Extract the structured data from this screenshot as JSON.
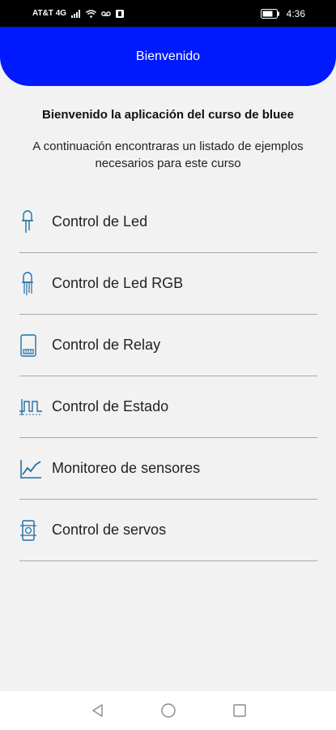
{
  "status_bar": {
    "carrier": "AT&T 4G",
    "time": "4:36",
    "icons": [
      "signal-icon",
      "wifi-icon",
      "voicemail-icon",
      "notification-icon",
      "battery-icon"
    ]
  },
  "header": {
    "title": "Bienvenido"
  },
  "intro": {
    "title": "Bienvenido la aplicación del curso de bluee",
    "description": "A continuación encontraras un listado de ejemplos necesarios para este curso"
  },
  "menu": {
    "items": [
      {
        "label": "Control de Led",
        "icon": "led-icon"
      },
      {
        "label": "Control de Led RGB",
        "icon": "led-rgb-icon"
      },
      {
        "label": "Control de Relay",
        "icon": "relay-icon"
      },
      {
        "label": "Control de Estado",
        "icon": "state-wave-icon"
      },
      {
        "label": "Monitoreo de sensores",
        "icon": "chart-line-icon"
      },
      {
        "label": "Control de servos",
        "icon": "servo-icon"
      }
    ]
  },
  "nav": {
    "buttons": [
      "back-icon",
      "home-icon",
      "recents-icon"
    ]
  },
  "colors": {
    "header": "#0019ff",
    "icon": "#1f6fa8",
    "background": "#f2f2f2"
  }
}
